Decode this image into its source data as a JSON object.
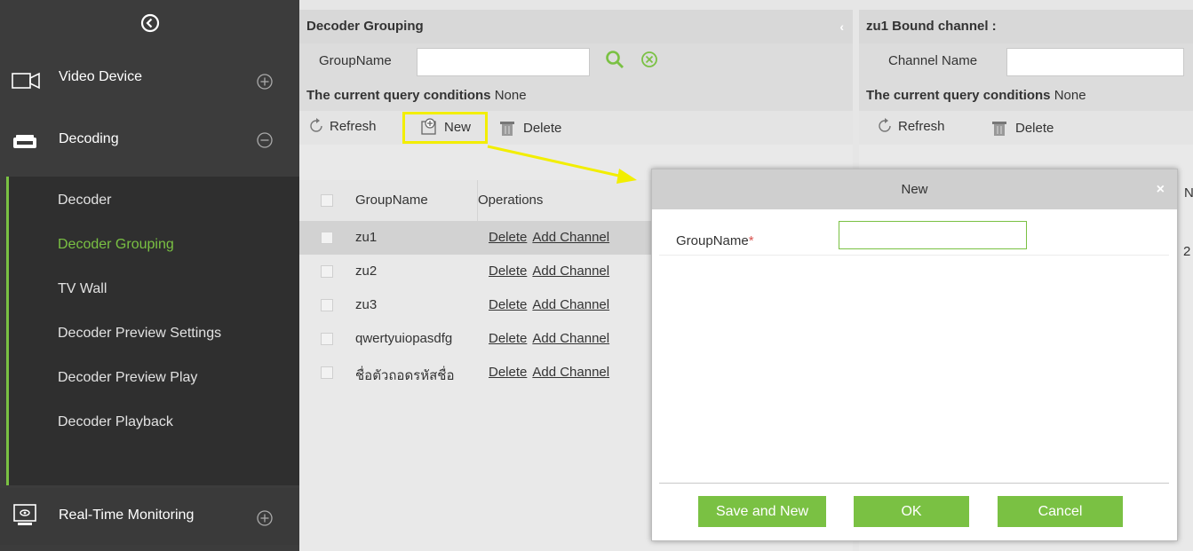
{
  "sidebar": {
    "categories": [
      {
        "label": "Video Device",
        "icon": "camera-icon",
        "toggle": "expand-icon"
      },
      {
        "label": "Decoding",
        "icon": "decoder-icon",
        "toggle": "collapse-icon"
      },
      {
        "label": "Real-Time Monitoring",
        "icon": "monitor-icon",
        "toggle": "expand-icon"
      }
    ],
    "items": [
      {
        "label": "Decoder",
        "active": false
      },
      {
        "label": "Decoder Grouping",
        "active": true
      },
      {
        "label": "TV Wall",
        "active": false
      },
      {
        "label": "Decoder Preview Settings",
        "active": false
      },
      {
        "label": "Decoder Preview Play",
        "active": false
      },
      {
        "label": "Decoder Playback",
        "active": false
      }
    ]
  },
  "grouping": {
    "title": "Decoder Grouping",
    "search_label": "GroupName",
    "query_label": "The current query conditions",
    "query_value": "None",
    "toolbar": {
      "refresh": "Refresh",
      "new": "New",
      "delete": "Delete"
    },
    "columns": [
      "GroupName",
      "Operations"
    ],
    "op_delete": "Delete",
    "op_add_channel": "Add Channel",
    "rows": [
      {
        "name": "zu1",
        "selected": true
      },
      {
        "name": "zu2",
        "selected": false
      },
      {
        "name": "zu3",
        "selected": false
      },
      {
        "name": "qwertyuiopasdfg",
        "selected": false
      },
      {
        "name": "ชื่อตัวถอดรหัสชื่อ",
        "selected": false
      }
    ]
  },
  "bound": {
    "title": "zu1 Bound channel :",
    "search_label": "Channel Name",
    "query_label": "The current query conditions",
    "query_value": "None",
    "toolbar": {
      "refresh": "Refresh",
      "delete": "Delete"
    },
    "header_partial": "N",
    "row_partial": "2"
  },
  "modal": {
    "title": "New",
    "close": "×",
    "field_label": "GroupName",
    "required_mark": "*",
    "field_value": "",
    "buttons": {
      "save_new": "Save and New",
      "ok": "OK",
      "cancel": "Cancel"
    }
  },
  "colors": {
    "accent": "#7ac143",
    "highlight": "#f2ee00",
    "sidebar_bg": "#3c3c3c"
  }
}
